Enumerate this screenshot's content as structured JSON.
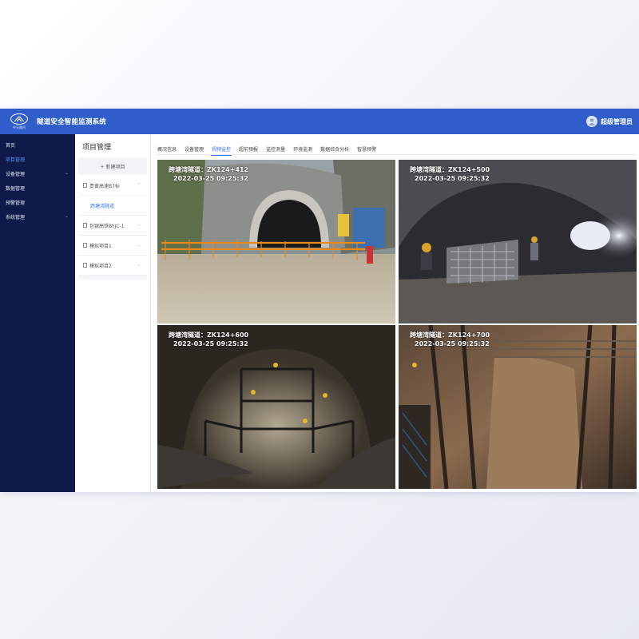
{
  "header": {
    "logo_caption": "中天路桥",
    "title": "隧道安全智能监测系统",
    "user_name": "超级管理员"
  },
  "sidebar": {
    "items": [
      {
        "label": "首页",
        "active": false,
        "has_children": false
      },
      {
        "label": "项目管理",
        "active": true,
        "has_children": false
      },
      {
        "label": "设备管理",
        "active": false,
        "has_children": true
      },
      {
        "label": "数据管理",
        "active": false,
        "has_children": false
      },
      {
        "label": "预警管理",
        "active": false,
        "has_children": false
      },
      {
        "label": "系统管理",
        "active": false,
        "has_children": true
      }
    ]
  },
  "project_panel": {
    "title": "项目管理",
    "new_button": "+ 新建项目",
    "projects": [
      {
        "label": "贵黄高速B7标",
        "expanded": true,
        "children": [
          "跨塘湾隧道"
        ]
      },
      {
        "label": "包银高铁BYJC-1",
        "expanded": false,
        "children": []
      },
      {
        "label": "模拟项目1",
        "expanded": false,
        "children": []
      },
      {
        "label": "模拟项目2",
        "expanded": false,
        "children": []
      }
    ]
  },
  "tabs": [
    {
      "label": "概况信息",
      "active": false
    },
    {
      "label": "设备管理",
      "active": false
    },
    {
      "label": "视频监控",
      "active": true
    },
    {
      "label": "超前预报",
      "active": false
    },
    {
      "label": "监控测量",
      "active": false
    },
    {
      "label": "环境监测",
      "active": false
    },
    {
      "label": "数据综合分析",
      "active": false
    },
    {
      "label": "智慧预警",
      "active": false
    }
  ],
  "cameras": [
    {
      "location": "跨塘湾隧道：ZK124+412",
      "timestamp": "2022-03-25 09:25:32"
    },
    {
      "location": "跨塘湾隧道：ZK124+500",
      "timestamp": "2022-03-25 09:25:32"
    },
    {
      "location": "跨塘湾隧道：ZK124+600",
      "timestamp": "2022-03-25 09:25:32"
    },
    {
      "location": "跨塘湾隧道：ZK124+700",
      "timestamp": "2022-03-25 09:25:32"
    }
  ],
  "colors": {
    "header_bg": "#2f5dc9",
    "sidebar_bg": "#0f1a4a",
    "accent": "#3a75e8"
  }
}
